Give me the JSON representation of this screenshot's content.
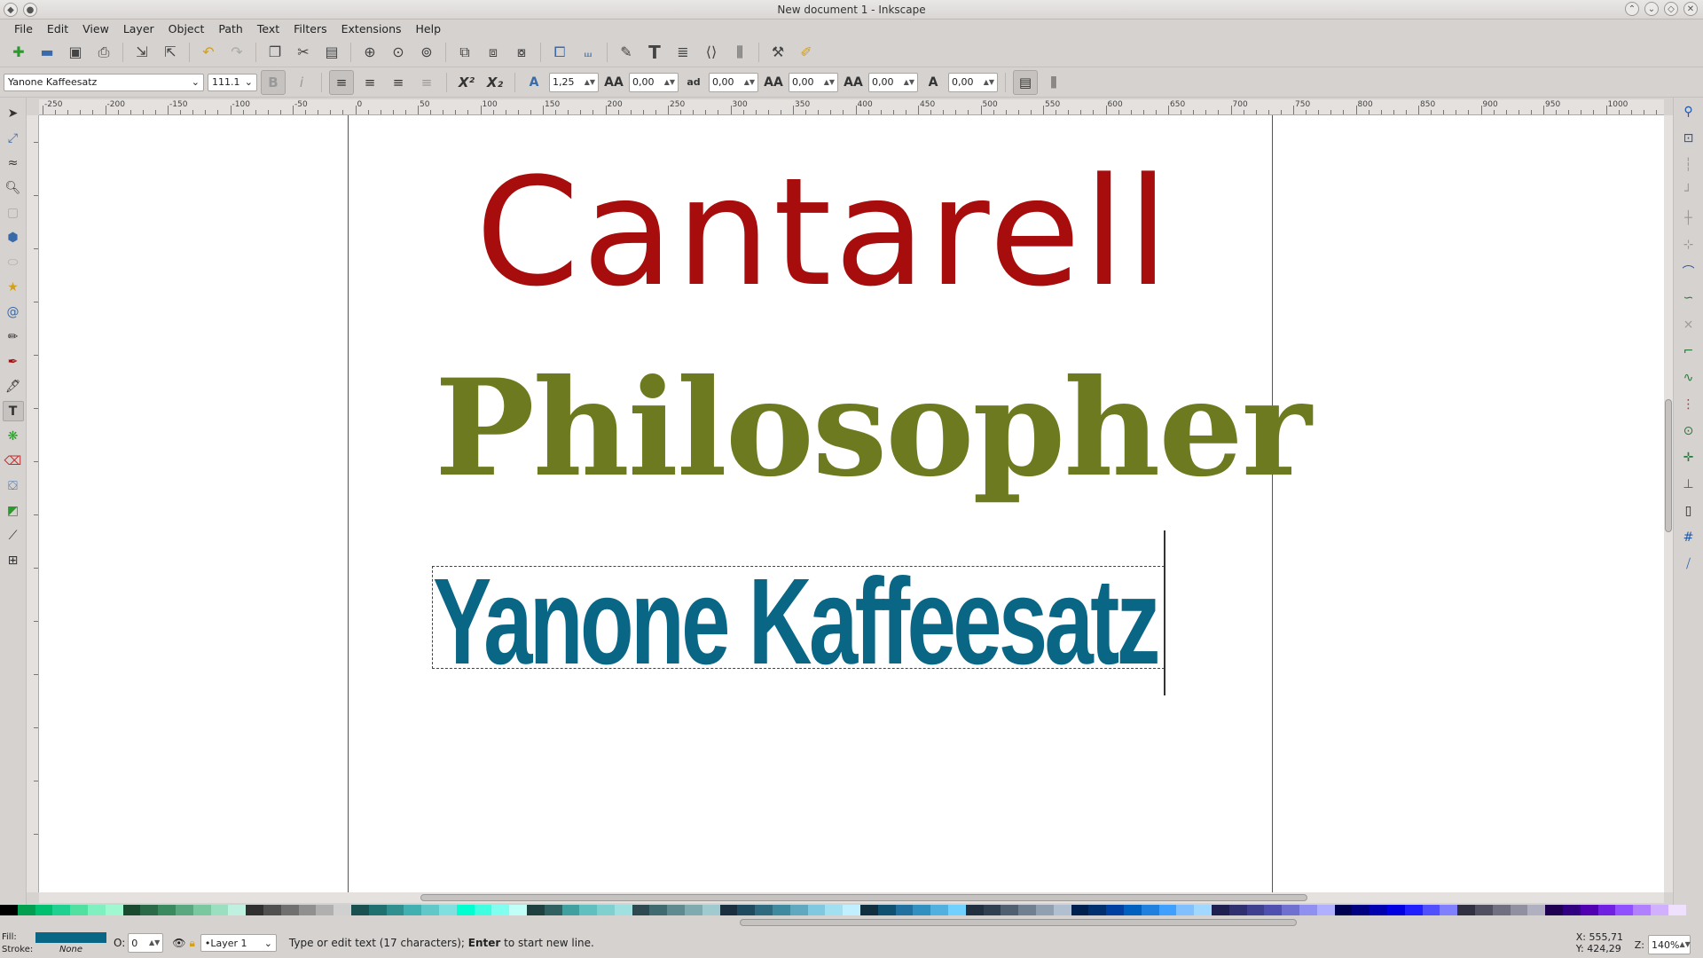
{
  "window": {
    "title": "New document 1 - Inkscape"
  },
  "menu": [
    "File",
    "Edit",
    "View",
    "Layer",
    "Object",
    "Path",
    "Text",
    "Filters",
    "Extensions",
    "Help"
  ],
  "text_toolbar": {
    "font_family": "Yanone Kaffeesatz",
    "font_size": "111.1",
    "line_spacing": "1,25",
    "letter_spacing": "0,00",
    "word_spacing": "0,00",
    "kerning": "0,00",
    "vertical_shift": "0,00",
    "rotation": "0,00"
  },
  "ruler": {
    "labels": [
      "-250",
      "-200",
      "-150",
      "-100",
      "-50",
      "0",
      "50",
      "100",
      "150",
      "200",
      "250",
      "300",
      "350",
      "400",
      "450",
      "500",
      "550",
      "600",
      "650",
      "700",
      "750",
      "800",
      "850",
      "900",
      "950",
      "1000"
    ]
  },
  "canvas": {
    "texts": [
      {
        "content": "Cantarell",
        "color": "#a80d0d"
      },
      {
        "content": "Philosopher",
        "color": "#6d7a1f"
      },
      {
        "content": "Yanone Kaffeesatz",
        "color": "#0a6685"
      }
    ]
  },
  "status": {
    "fill_label": "Fill:",
    "stroke_label": "Stroke:",
    "stroke_value": "None",
    "opacity_label": "O:",
    "opacity_value": "0",
    "layer": "•Layer 1",
    "message_prefix": "Type or edit text (17 characters);",
    "message_key": "Enter",
    "message_suffix": "to start new line.",
    "x": "X:  555,71",
    "y": "Y:  424,29",
    "zoom_label": "Z:",
    "zoom_value": "140%"
  },
  "palette_colors": [
    "#000000",
    "#00a050",
    "#00c070",
    "#20d090",
    "#50e0a0",
    "#80f0c0",
    "#a0f8d0",
    "#1a4a30",
    "#2a6a48",
    "#3a8a60",
    "#5aa880",
    "#7ac8a0",
    "#9ae0c0",
    "#c0f0e0",
    "#303030",
    "#505050",
    "#707070",
    "#909090",
    "#b0b0b0",
    "#d0d0d0",
    "#1a5050",
    "#207070",
    "#309090",
    "#40b0b0",
    "#60c8c8",
    "#80e0e0",
    "#00ffd0",
    "#40ffe0",
    "#80fff0",
    "#c0fff8",
    "#204040",
    "#306060",
    "#40a0a0",
    "#60c0c0",
    "#80d0d0",
    "#a0e0e0",
    "#2e4a50",
    "#3e6a70",
    "#5e8a90",
    "#7eaab0",
    "#9ecad0",
    "#1a3040",
    "#204a60",
    "#306a80",
    "#408aa0",
    "#60a8c0",
    "#80c8e0",
    "#a0e0f0",
    "#c0f0ff",
    "#103040",
    "#105070",
    "#2070a0",
    "#3090c0",
    "#50b0e0",
    "#70d0ff",
    "#203040",
    "#304050",
    "#506070",
    "#708090",
    "#90a0b0",
    "#b0c0d0",
    "#002050",
    "#003070",
    "#0040a0",
    "#0060c0",
    "#2080e0",
    "#40a0ff",
    "#80c0ff",
    "#a0d8ff",
    "#202050",
    "#303070",
    "#404090",
    "#5050b0",
    "#7070d0",
    "#9090f0",
    "#b0b0ff",
    "#000050",
    "#000080",
    "#0000b0",
    "#0000e0",
    "#2020ff",
    "#5050ff",
    "#8080ff",
    "#303040",
    "#505060",
    "#707080",
    "#9090a0",
    "#b0b0c0",
    "#200050",
    "#300080",
    "#5000b0",
    "#7020e0",
    "#9050ff",
    "#b080ff",
    "#d0b0ff",
    "#f0e0ff"
  ]
}
